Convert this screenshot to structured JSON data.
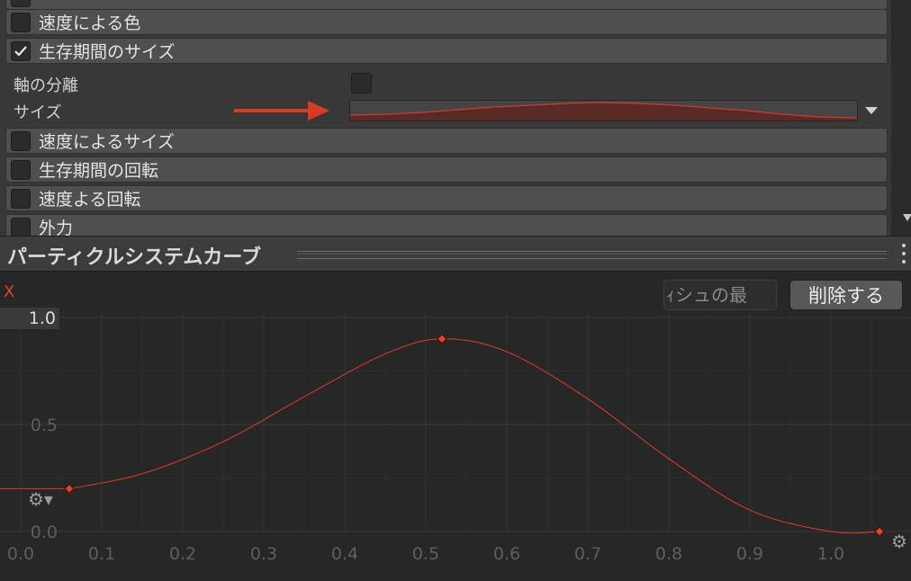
{
  "inspector": {
    "modules": [
      {
        "label": "",
        "checked": false
      },
      {
        "label": "速度による色",
        "checked": false
      },
      {
        "label": "生存期間のサイズ",
        "checked": true
      },
      {
        "label": "速度によるサイズ",
        "checked": false
      },
      {
        "label": "生存期間の回転",
        "checked": false
      },
      {
        "label": "速度よる回転",
        "checked": false
      },
      {
        "label": "外力",
        "checked": false
      }
    ],
    "size_module": {
      "separate_axes_label": "軸の分離",
      "separate_axes_checked": false,
      "size_label": "サイズ"
    }
  },
  "panel": {
    "title": "パーティクルシステムカーブ",
    "curve_name": "X",
    "preset_placeholder": "ｨシュの最",
    "delete_label": "削除する"
  },
  "chart_data": {
    "type": "line",
    "title": "",
    "xlabel": "",
    "ylabel": "",
    "xlim": [
      0.0,
      1.0
    ],
    "ylim": [
      0.0,
      1.0
    ],
    "x_ticks": [
      "0.0",
      "0.1",
      "0.2",
      "0.3",
      "0.4",
      "0.5",
      "0.6",
      "0.7",
      "0.8",
      "0.9",
      "1.0"
    ],
    "y_ticks": [
      "0.0",
      "0.5",
      "1.0"
    ],
    "grid": true,
    "series": [
      {
        "color": "#e03a2d",
        "keys": [
          {
            "x": 0.06,
            "y": 0.2
          },
          {
            "x": 0.52,
            "y": 0.9
          },
          {
            "x": 1.06,
            "y": 0.0
          }
        ],
        "x": [
          0.06,
          0.15,
          0.25,
          0.35,
          0.45,
          0.52,
          0.6,
          0.7,
          0.8,
          0.9,
          1.0,
          1.06
        ],
        "y": [
          0.2,
          0.27,
          0.42,
          0.63,
          0.83,
          0.9,
          0.84,
          0.62,
          0.34,
          0.1,
          0.0,
          0.0
        ]
      }
    ]
  },
  "colors": {
    "curve": "#e03a2d",
    "annotation_arrow": "#d93a22"
  },
  "icons": [
    "checkmark-icon",
    "dropdown-arrow-icon",
    "kebab-menu-icon",
    "gear-icon"
  ]
}
